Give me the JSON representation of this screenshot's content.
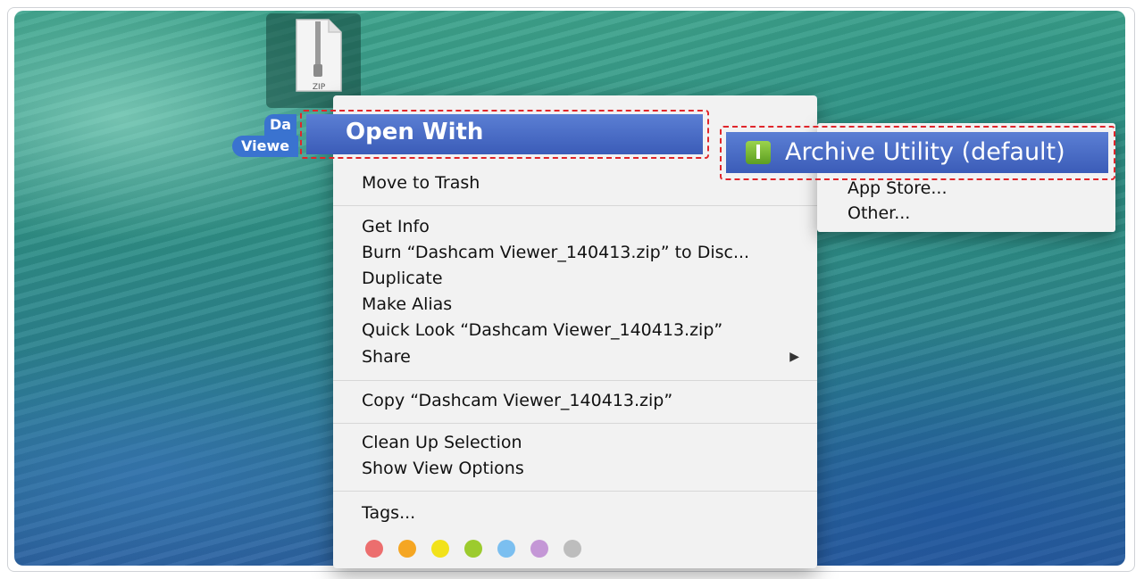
{
  "file": {
    "icon_caption": "ZIP",
    "label_line1": "Da",
    "label_line2": "Viewe"
  },
  "context_menu": {
    "open_with": "Open With",
    "move_to_trash": "Move to Trash",
    "get_info": "Get Info",
    "burn": "Burn “Dashcam Viewer_140413.zip” to Disc...",
    "duplicate": "Duplicate",
    "make_alias": "Make Alias",
    "quick_look": "Quick Look “Dashcam Viewer_140413.zip”",
    "share": "Share",
    "share_arrow": "▶",
    "copy": "Copy “Dashcam Viewer_140413.zip”",
    "clean_up": "Clean Up Selection",
    "show_view_options": "Show View Options",
    "tags": "Tags..."
  },
  "tags": [
    {
      "name": "red",
      "color": "#ec6e6e"
    },
    {
      "name": "orange",
      "color": "#f5a623"
    },
    {
      "name": "yellow",
      "color": "#f2e21a"
    },
    {
      "name": "green",
      "color": "#9ccb2e"
    },
    {
      "name": "blue",
      "color": "#7bbff0"
    },
    {
      "name": "purple",
      "color": "#c497d6"
    },
    {
      "name": "gray",
      "color": "#bdbdbd"
    }
  ],
  "open_with_submenu": {
    "archive_utility": "Archive Utility (default)",
    "app_store": "App Store...",
    "other": "Other..."
  },
  "colors": {
    "highlight": "#3b5cb8",
    "annotation": "#e0262b"
  }
}
